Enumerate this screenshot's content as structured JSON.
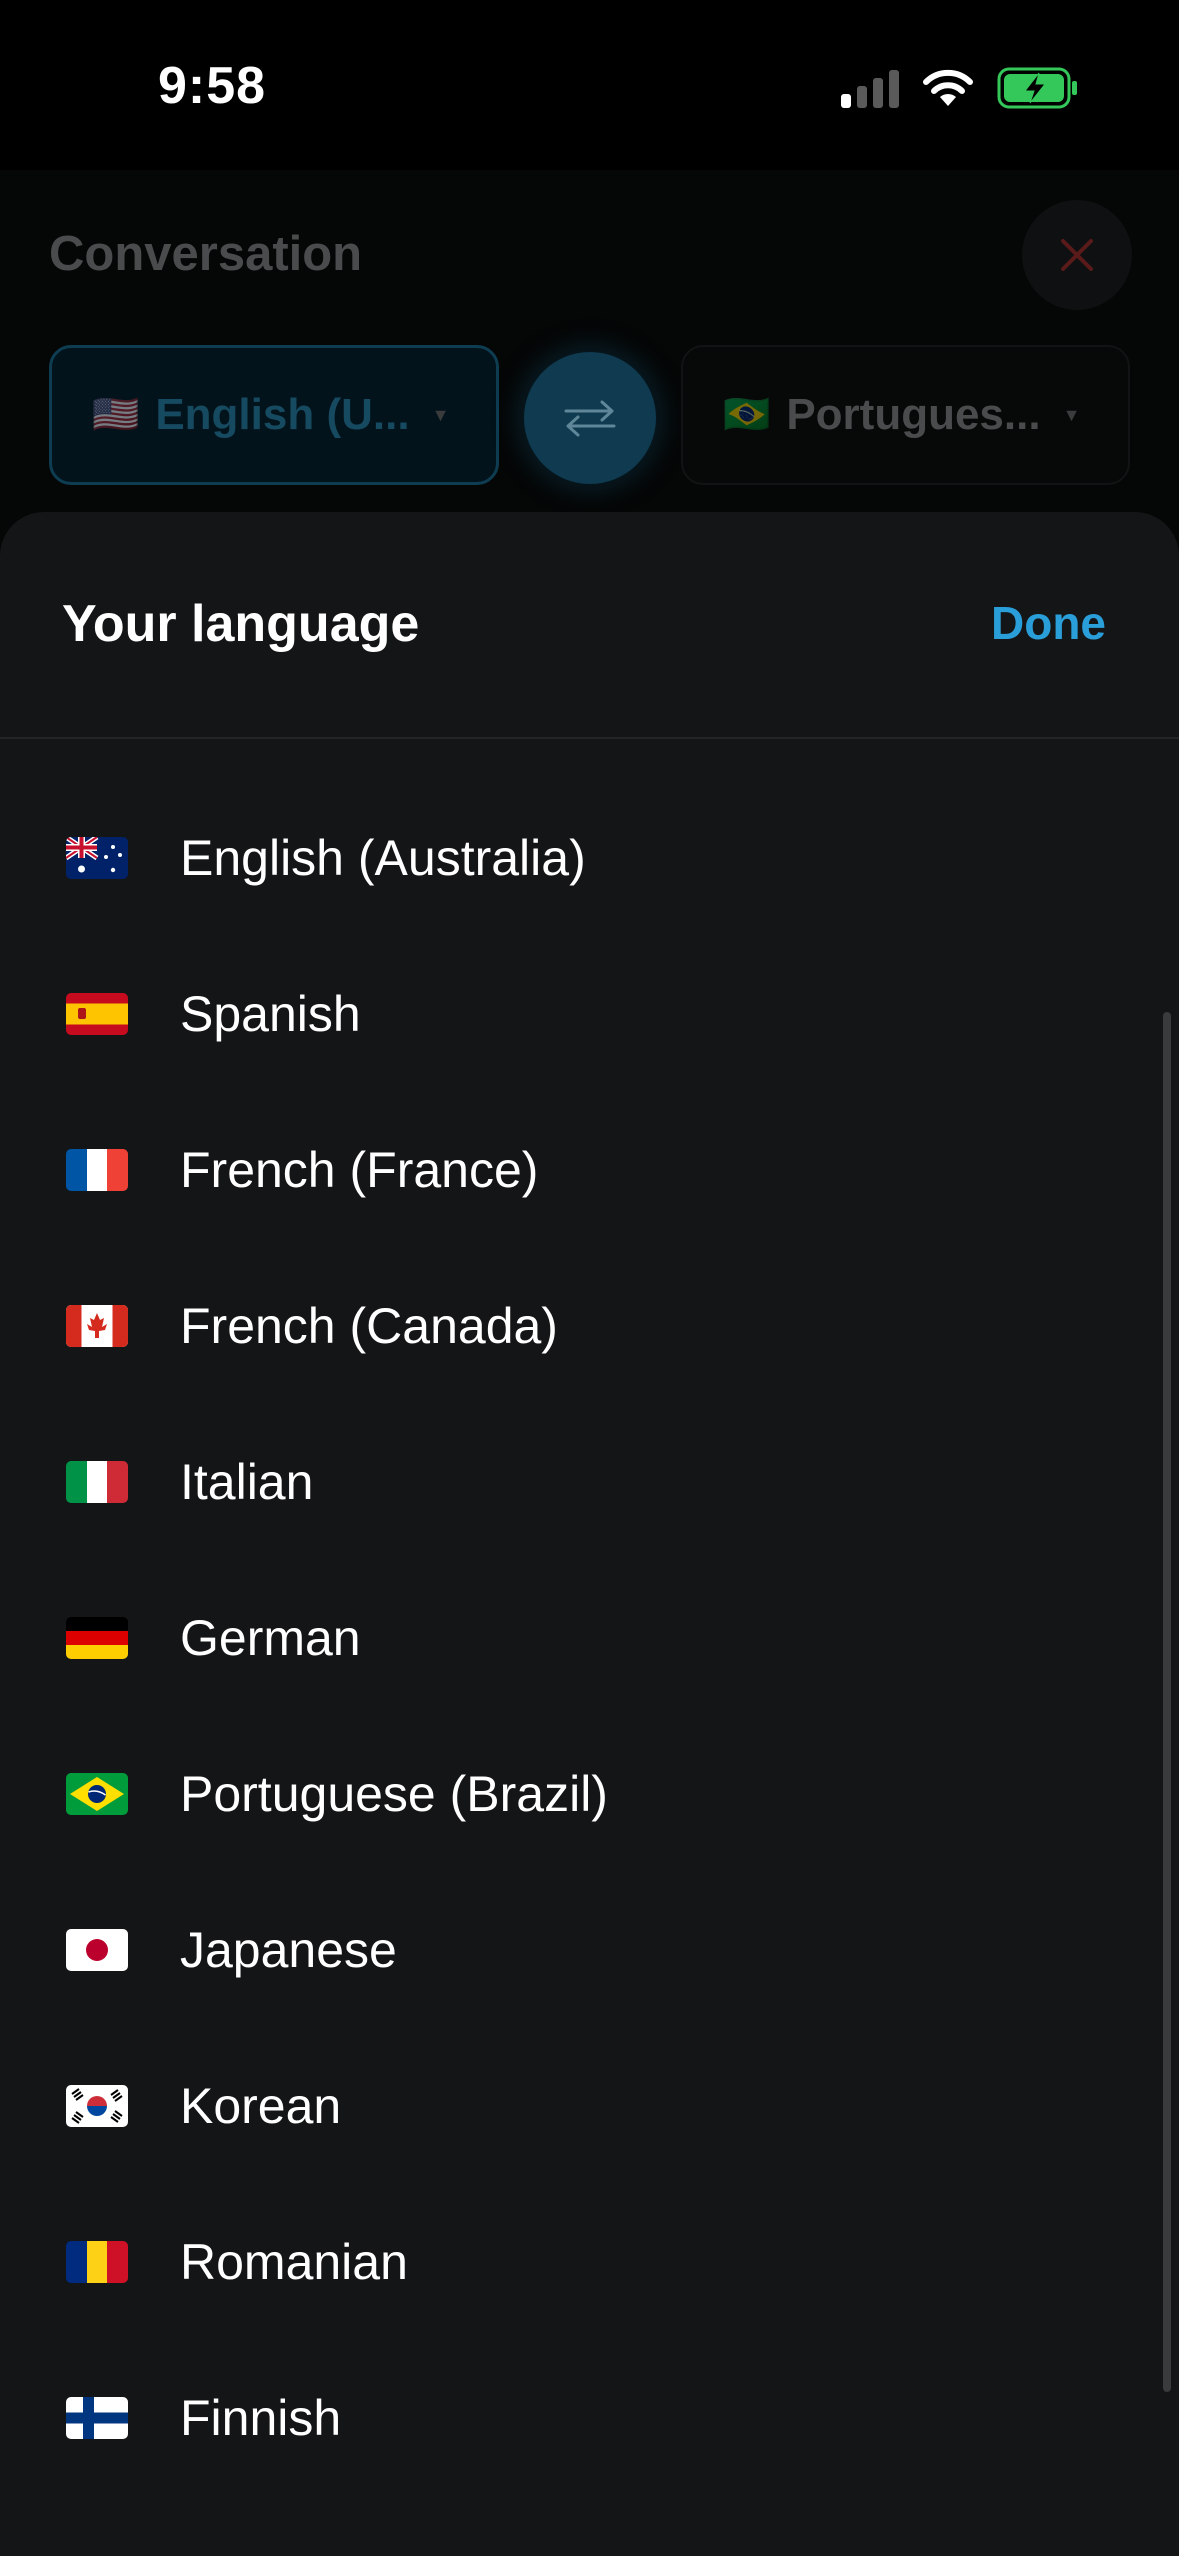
{
  "status_bar": {
    "time": "9:58",
    "icons": [
      "cellular-signal-icon",
      "wifi-icon",
      "battery-charging-icon"
    ],
    "battery_color": "#34c759"
  },
  "background": {
    "title": "Conversation",
    "close_icon": "close-icon",
    "source_language": {
      "flag": "🇺🇸",
      "label": "English (U..."
    },
    "target_language": {
      "flag": "🇧🇷",
      "label": "Portugues..."
    },
    "swap_icon": "swap-arrows-icon"
  },
  "sheet": {
    "title": "Your language",
    "done_label": "Done",
    "accent_color": "#2a9ed8",
    "languages": [
      {
        "flag": "au",
        "label": "English (Australia)"
      },
      {
        "flag": "es",
        "label": "Spanish"
      },
      {
        "flag": "fr",
        "label": "French (France)"
      },
      {
        "flag": "ca",
        "label": "French (Canada)"
      },
      {
        "flag": "it",
        "label": "Italian"
      },
      {
        "flag": "de",
        "label": "German"
      },
      {
        "flag": "br",
        "label": "Portuguese (Brazil)"
      },
      {
        "flag": "jp",
        "label": "Japanese"
      },
      {
        "flag": "kr",
        "label": "Korean"
      },
      {
        "flag": "ro",
        "label": "Romanian"
      },
      {
        "flag": "fi",
        "label": "Finnish"
      }
    ]
  }
}
